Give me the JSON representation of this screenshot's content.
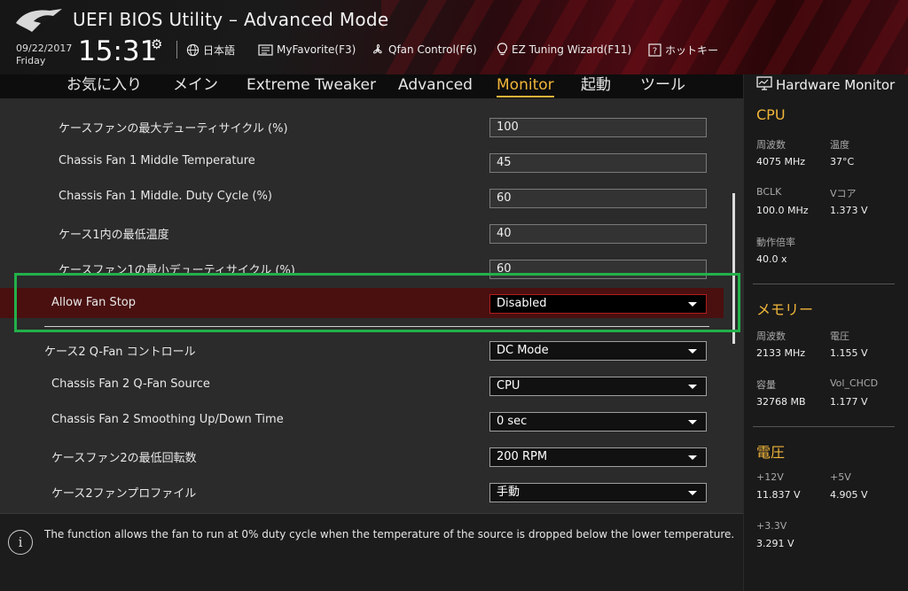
{
  "header": {
    "title": "UEFI BIOS Utility – Advanced Mode",
    "date": "09/22/2017",
    "day": "Friday",
    "time": "15:31",
    "toolbar": [
      {
        "icon": "globe-icon",
        "label": "日本語"
      },
      {
        "icon": "myfavorite-icon",
        "label": "MyFavorite(F3)"
      },
      {
        "icon": "fan-icon",
        "label": "Qfan Control(F6)"
      },
      {
        "icon": "lightbulb-icon",
        "label": "EZ Tuning Wizard(F11)"
      },
      {
        "icon": "help-icon",
        "label": "ホットキー"
      }
    ]
  },
  "nav": {
    "tabs": [
      "お気に入り",
      "メイン",
      "Extreme Tweaker",
      "Advanced",
      "Monitor",
      "起動",
      "ツール"
    ],
    "active": "Monitor"
  },
  "settings": [
    {
      "label": "ケースファンの最大デューティサイクル (%)",
      "value": "100",
      "type": "text"
    },
    {
      "label": "Chassis Fan 1 Middle Temperature",
      "value": "45",
      "type": "text"
    },
    {
      "label": "Chassis Fan 1 Middle. Duty Cycle (%)",
      "value": "60",
      "type": "text"
    },
    {
      "label": "ケース1内の最低温度",
      "value": "40",
      "type": "text"
    },
    {
      "label": "ケースファン1の最小デューティサイクル (%)",
      "value": "60",
      "type": "text"
    },
    {
      "label": "Allow Fan Stop",
      "value": "Disabled",
      "type": "dropdown",
      "selected": true
    },
    {
      "label": "ケース2 Q-Fan コントロール",
      "value": "DC Mode",
      "type": "dropdown"
    },
    {
      "label": "Chassis Fan 2 Q-Fan Source",
      "value": "CPU",
      "type": "dropdown"
    },
    {
      "label": "Chassis Fan 2 Smoothing Up/Down Time",
      "value": "0 sec",
      "type": "dropdown"
    },
    {
      "label": "ケースファン2の最低回転数",
      "value": "200 RPM",
      "type": "dropdown"
    },
    {
      "label": "ケース2ファンプロファイル",
      "value": "手動",
      "type": "dropdown"
    }
  ],
  "help": {
    "text": "The function allows the fan to run at 0% duty cycle when the temperature of the source is dropped below the lower temperature."
  },
  "hardware_monitor": {
    "title": "Hardware Monitor",
    "cpu": {
      "heading": "CPU",
      "freq_label": "周波数",
      "freq": "4075 MHz",
      "temp_label": "温度",
      "temp": "37°C",
      "bclk_label": "BCLK",
      "bclk": "100.0 MHz",
      "vcore_label": "Vコア",
      "vcore": "1.373 V",
      "ratio_label": "動作倍率",
      "ratio": "40.0 x"
    },
    "memory": {
      "heading": "メモリー",
      "freq_label": "周波数",
      "freq": "2133 MHz",
      "volt_label": "電圧",
      "volt": "1.155 V",
      "cap_label": "容量",
      "cap": "32768 MB",
      "vol_chcd_label": "Vol_CHCD",
      "vol_chcd": "1.177 V"
    },
    "voltage": {
      "heading": "電圧",
      "v12_label": "+12V",
      "v12": "11.837 V",
      "v5_label": "+5V",
      "v5": "4.905 V",
      "v33_label": "+3.3V",
      "v33": "3.291 V"
    }
  },
  "colors": {
    "accent": "#f0b53a",
    "selection": "#4a1010",
    "highlight_box": "#23b04a"
  }
}
